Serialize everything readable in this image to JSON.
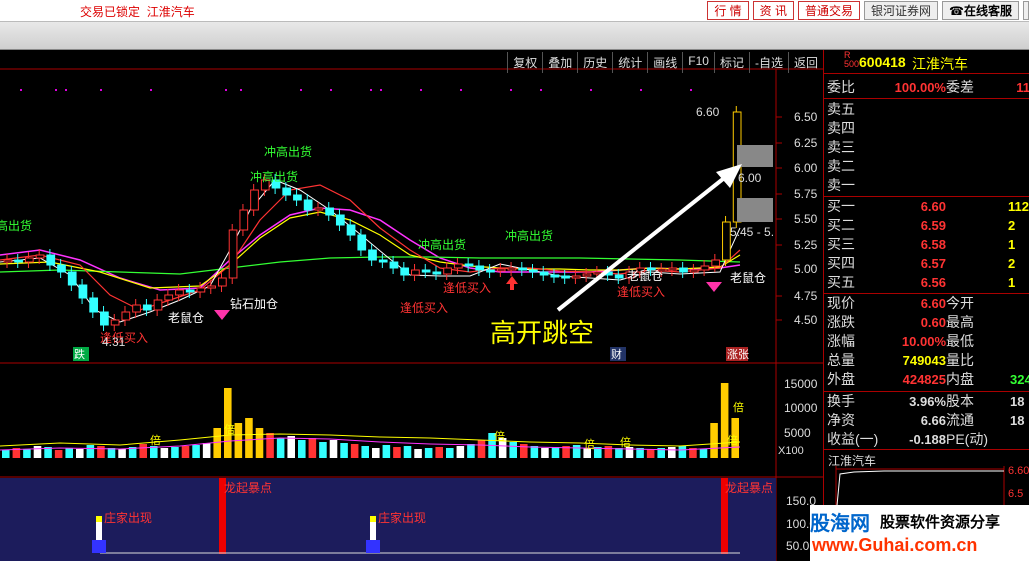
{
  "top": {
    "status": "交易已锁定",
    "stock_name": "江淮汽车",
    "buttons": [
      "行 情",
      "资 讯",
      "普通交易"
    ],
    "broker": "银河证券网",
    "service": "在线客服"
  },
  "toolbar": [
    "复权",
    "叠加",
    "历史",
    "统计",
    "画线",
    "F10",
    "标记",
    "-自选",
    "返回"
  ],
  "chart": {
    "price_ticks": [
      "6.50",
      "6.25",
      "6.00",
      "5.75",
      "5.50",
      "5.25",
      "5.00",
      "4.75",
      "4.50"
    ],
    "vol_ticks": [
      "15000",
      "10000",
      "5000"
    ],
    "vol_unit": "X100",
    "ind_ticks": [
      "150.0",
      "100.0",
      "50.0"
    ],
    "annotations": {
      "chonggao": "冲高出货",
      "zuandi": "逢低买入",
      "laoshu": "老鼠仓",
      "zuanshi": "钻石加仓",
      "high_ann": "6.60",
      "mid_ann": "6.00",
      "low_ann": "4.31",
      "range_ann": "5.45 - 5.",
      "gap": "高开跳空",
      "die": "跌",
      "cai": "财",
      "zhangting": "涨张",
      "bei": "倍",
      "dragon": "龙起暴点",
      "zhuangjia": "庄家出现",
      "chonggao_left": "高出货",
      "laoshu2": "老鼠仓"
    }
  },
  "quote": {
    "code": "600418",
    "name": "江淮汽车",
    "badge_top": "R",
    "badge_bot": "500",
    "weibi_label": "委比",
    "weibi": "100.00%",
    "weicha_label": "委差",
    "weicha": "11",
    "sell": [
      "卖五",
      "卖四",
      "卖三",
      "卖二",
      "卖一"
    ],
    "buy": [
      {
        "label": "买一",
        "price": "6.60",
        "vol": "112"
      },
      {
        "label": "买二",
        "price": "6.59",
        "vol": "2"
      },
      {
        "label": "买三",
        "price": "6.58",
        "vol": "1"
      },
      {
        "label": "买四",
        "price": "6.57",
        "vol": "2"
      },
      {
        "label": "买五",
        "price": "6.56",
        "vol": "1"
      }
    ],
    "stats": [
      {
        "l": "现价",
        "v": "6.60",
        "l2": "今开",
        "v2": ""
      },
      {
        "l": "涨跌",
        "v": "0.60",
        "l2": "最高",
        "v2": ""
      },
      {
        "l": "涨幅",
        "v": "10.00%",
        "l2": "最低",
        "v2": ""
      },
      {
        "l": "总量",
        "v": "749043",
        "l2": "量比",
        "v2": ""
      },
      {
        "l": "外盘",
        "v": "424825",
        "l2": "内盘",
        "v2": "324"
      }
    ],
    "stats2": [
      {
        "l": "换手",
        "v": "3.96%",
        "l2": "股本",
        "v2": "18"
      },
      {
        "l": "净资",
        "v": "6.66",
        "l2": "流通",
        "v2": "18"
      },
      {
        "l": "收益(一)",
        "v": "-0.188",
        "l2": "PE(动)",
        "v2": ""
      }
    ],
    "mini_title": "江淮汽车",
    "mini_ticks": [
      "6.60",
      "6.5"
    ]
  },
  "watermark": {
    "logo": "股海网",
    "slogan": "股票软件资源分享",
    "url": "www.Guhai.com.cn"
  },
  "colors": {
    "up": "#ff3333",
    "down": "#33ffff",
    "ma5": "#ffffff",
    "ma10": "#ffff00",
    "ma20": "#ff33ff",
    "ma60": "#33ff33",
    "limit": "#ffcc00"
  }
}
